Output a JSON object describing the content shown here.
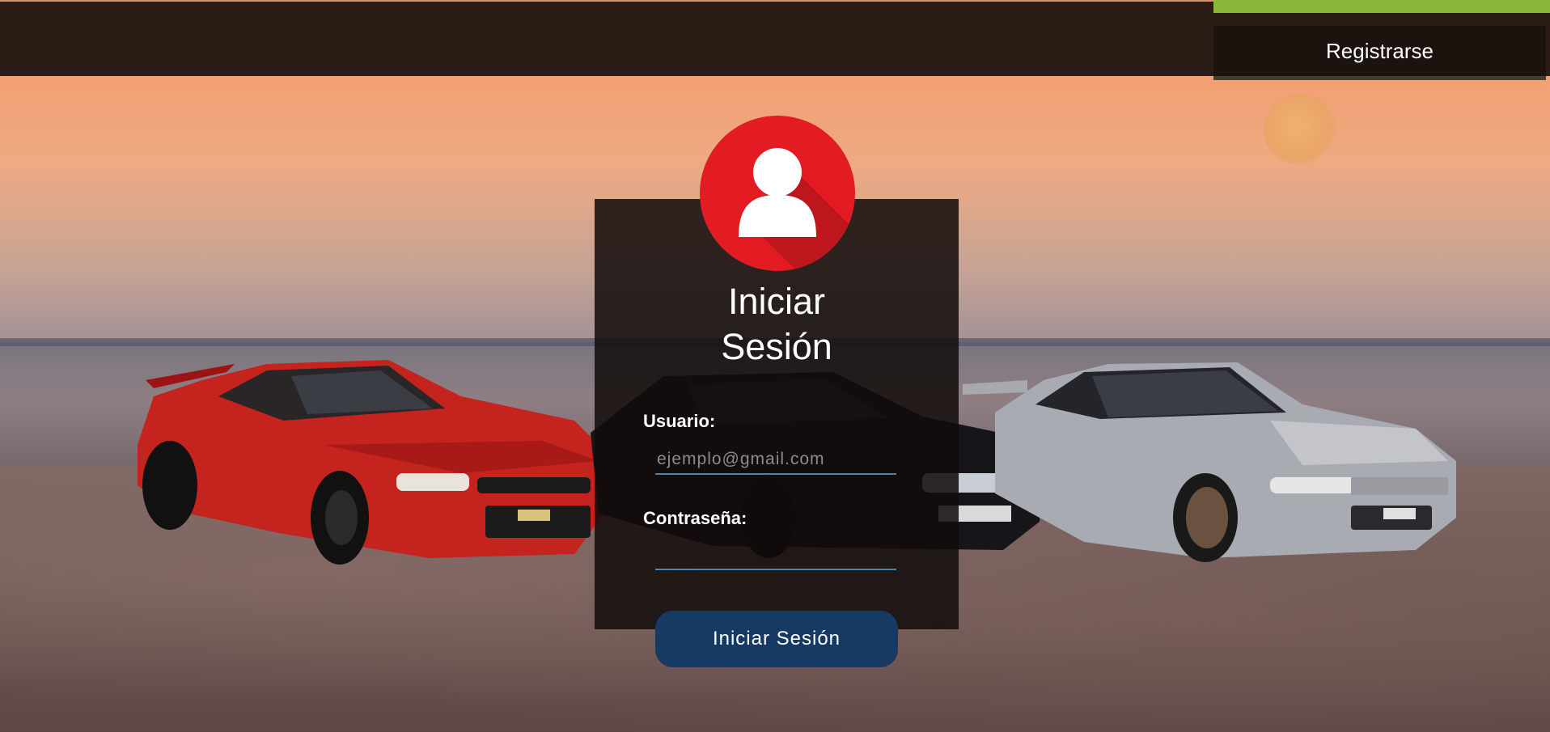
{
  "header": {
    "register_label": "Registrarse"
  },
  "login": {
    "avatar_icon": "user-icon",
    "title_line1": "Iniciar",
    "title_line2": "Sesión",
    "username_label": "Usuario:",
    "username_placeholder": "ejemplo@gmail.com",
    "username_value": "",
    "password_label": "Contraseña:",
    "password_value": "",
    "submit_label": "Iniciar Sesión"
  },
  "colors": {
    "topbar": "#2b1d16",
    "accent_green": "#8cb63c",
    "avatar_red": "#e31b23",
    "button_blue": "#163a64",
    "input_underline": "#3f86b3"
  }
}
